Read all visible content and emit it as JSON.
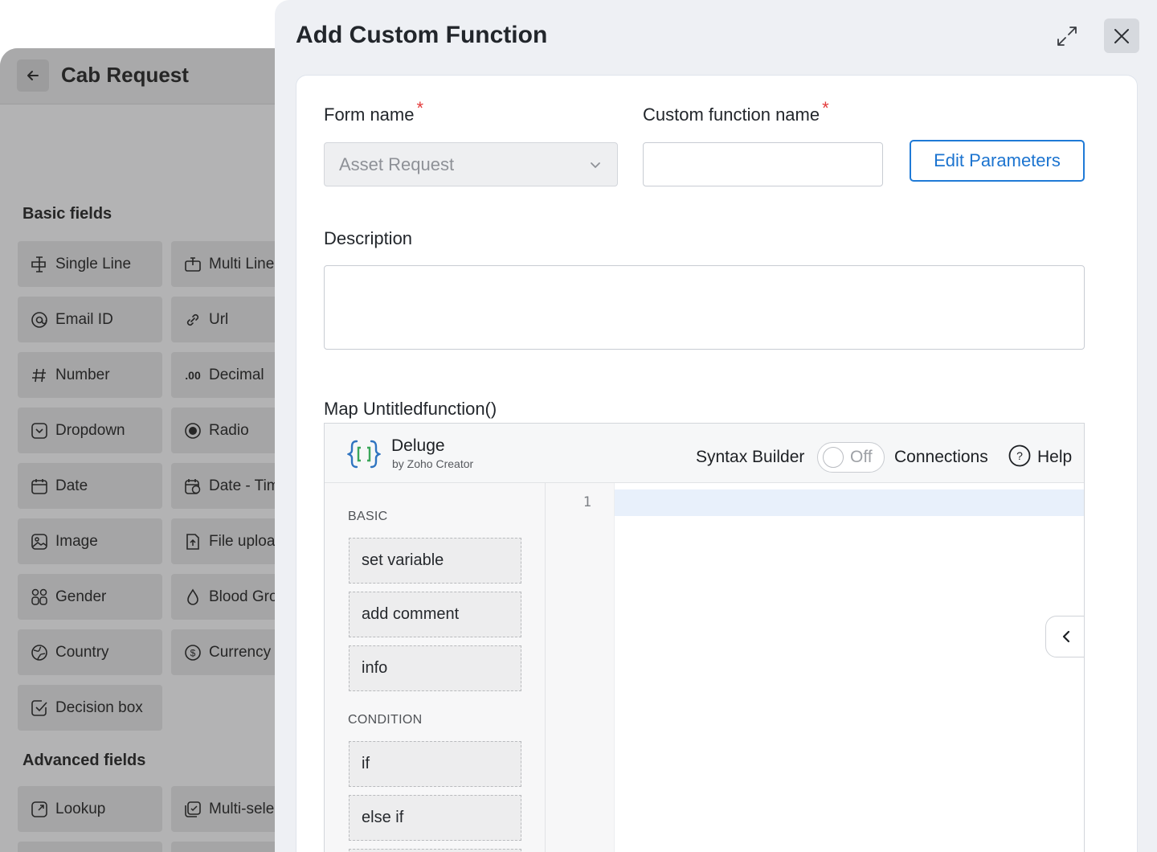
{
  "background": {
    "title": "Cab Request",
    "basic_fields_heading": "Basic fields",
    "advanced_fields_heading": "Advanced fields",
    "basic_fields": [
      {
        "label": "Single Line",
        "icon": "single-line-icon"
      },
      {
        "label": "Multi Line",
        "icon": "multi-line-icon"
      },
      {
        "label": "Email ID",
        "icon": "at-icon"
      },
      {
        "label": "Url",
        "icon": "link-icon"
      },
      {
        "label": "Number",
        "icon": "hash-icon"
      },
      {
        "label": "Decimal",
        "icon": "decimal-icon"
      },
      {
        "label": "Dropdown",
        "icon": "dropdown-icon"
      },
      {
        "label": "Radio",
        "icon": "radio-icon"
      },
      {
        "label": "Date",
        "icon": "calendar-icon"
      },
      {
        "label": "Date - Time",
        "icon": "calendar-clock-icon"
      },
      {
        "label": "Image",
        "icon": "image-icon"
      },
      {
        "label": "File upload",
        "icon": "file-upload-icon"
      },
      {
        "label": "Gender",
        "icon": "gender-icon"
      },
      {
        "label": "Blood Group",
        "icon": "drop-icon"
      },
      {
        "label": "Country",
        "icon": "globe-icon"
      },
      {
        "label": "Currency",
        "icon": "currency-icon"
      },
      {
        "label": "Decision box",
        "icon": "checkbox-icon"
      }
    ],
    "advanced_fields": [
      {
        "label": "Lookup",
        "icon": "lookup-icon"
      },
      {
        "label": "Multi-select",
        "icon": "multi-select-icon"
      }
    ]
  },
  "modal": {
    "title": "Add Custom Function",
    "form_name_label": "Form name",
    "form_name_value": "Asset Request",
    "custom_function_label": "Custom function name",
    "custom_function_value": "",
    "edit_parameters_label": "Edit Parameters",
    "description_label": "Description",
    "description_value": "",
    "map_label": "Map Untitledfunction()",
    "required_marker": "*"
  },
  "editor": {
    "brand_name": "Deluge",
    "brand_sub": "by Zoho Creator",
    "syntax_builder_label": "Syntax Builder",
    "toggle_state": "Off",
    "connections_label": "Connections",
    "help_label": "Help",
    "line_numbers": [
      "1"
    ],
    "palette": [
      {
        "heading": "BASIC",
        "items": [
          "set variable",
          "add comment",
          "info"
        ]
      },
      {
        "heading": "CONDITION",
        "items": [
          "if",
          "else if"
        ]
      }
    ]
  },
  "colors": {
    "accent": "#1f7ad6",
    "required": "#e33b3b",
    "overlay": "#b3b3b4"
  }
}
